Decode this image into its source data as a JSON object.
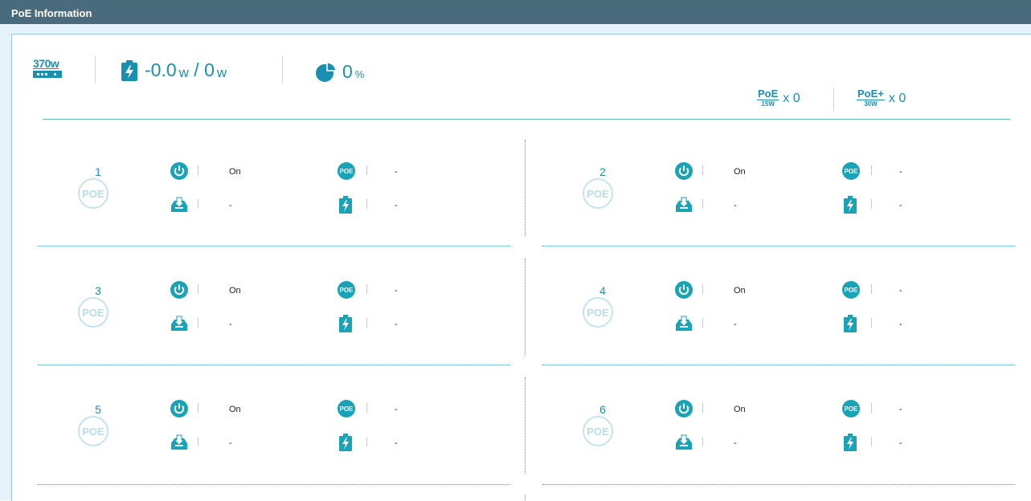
{
  "window": {
    "title": "PoE Information"
  },
  "summary": {
    "budget": "370w",
    "power_value": "-0.0",
    "power_unit1": "w",
    "power_sep": " / ",
    "power_total": "0",
    "power_unit2": "w",
    "percent_value": "0",
    "percent_unit": "%",
    "poe_class": {
      "num": "PoE",
      "den": "15W",
      "count": "x 0"
    },
    "poeplus_class": {
      "num": "PoE+",
      "den": "30W",
      "count": "x 0"
    }
  },
  "ports": [
    {
      "number": "1",
      "badge": "POE",
      "status": "On",
      "poe": "-",
      "class": "-",
      "power": "-"
    },
    {
      "number": "2",
      "badge": "POE",
      "status": "On",
      "poe": "-",
      "class": "-",
      "power": "-"
    },
    {
      "number": "3",
      "badge": "POE",
      "status": "On",
      "poe": "-",
      "class": "-",
      "power": "-"
    },
    {
      "number": "4",
      "badge": "POE",
      "status": "On",
      "poe": "-",
      "class": "-",
      "power": "-"
    },
    {
      "number": "5",
      "badge": "POE",
      "status": "On",
      "poe": "-",
      "class": "-",
      "power": "-"
    },
    {
      "number": "6",
      "badge": "POE",
      "status": "On",
      "poe": "-",
      "class": "-",
      "power": "-"
    }
  ],
  "icons": {
    "budget": "switch-budget-icon",
    "power": "battery-bolt-icon",
    "percent": "pie-chart-icon",
    "status": "power-icon",
    "poe": "poe-badge-icon",
    "class": "inbox-download-icon",
    "consumption": "battery-bolt-icon"
  },
  "colors": {
    "accent": "#1a8fb0",
    "teal": "#19a3b6",
    "header": "#4a6b7b"
  }
}
